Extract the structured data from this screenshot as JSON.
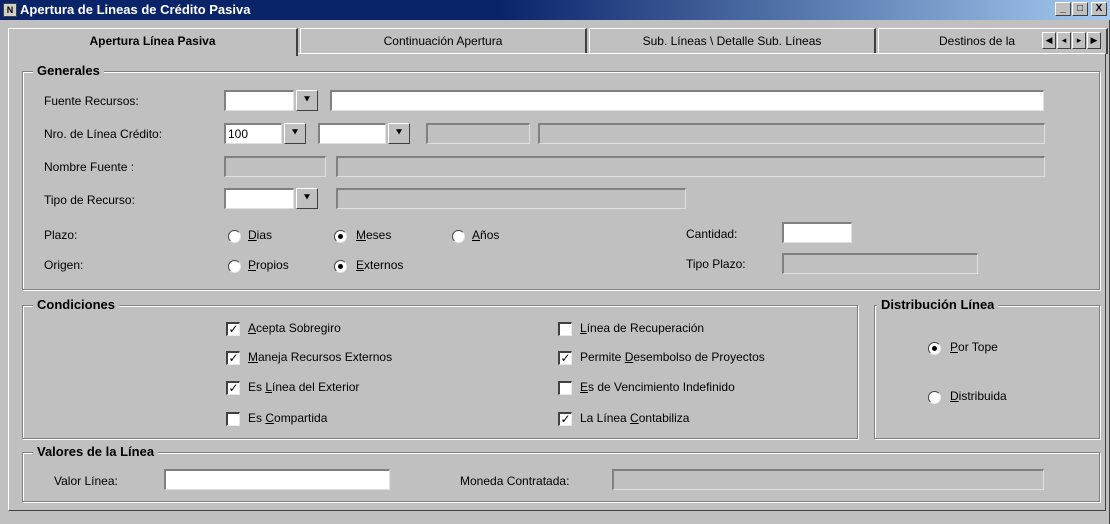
{
  "window": {
    "title": "Apertura de Lineas de Crédito Pasiva",
    "icon_label": "N",
    "controls": [
      "_",
      "□",
      "X"
    ]
  },
  "tabs": [
    {
      "label": "Apertura Línea Pasiva",
      "active": true
    },
    {
      "label": "Continuación Apertura",
      "active": false
    },
    {
      "label": "Sub. Líneas \\ Detalle Sub. Líneas",
      "active": false
    },
    {
      "label": "Destinos de la",
      "active": false
    }
  ],
  "tab_nav": [
    "first-icon",
    "prev-icon",
    "next-icon",
    "last-icon"
  ],
  "generales": {
    "title": "Generales",
    "fuente_recursos": {
      "label": "Fuente Recursos:",
      "code": "",
      "description": ""
    },
    "nro_linea": {
      "label": "Nro. de Línea Crédito:",
      "value": "100",
      "sub": "",
      "field3": "",
      "field4": ""
    },
    "nombre_fuente": {
      "label": "Nombre Fuente :",
      "code": "",
      "description": ""
    },
    "tipo_recurso": {
      "label": "Tipo de Recurso:",
      "code": "",
      "description": ""
    },
    "plazo": {
      "label": "Plazo:",
      "options": [
        {
          "pre": "",
          "u": "D",
          "post": "ias",
          "selected": false
        },
        {
          "pre": "",
          "u": "M",
          "post": "eses",
          "selected": true
        },
        {
          "pre": "",
          "u": "A",
          "post": "ños",
          "selected": false
        }
      ]
    },
    "origen": {
      "label": "Origen:",
      "options": [
        {
          "pre": "",
          "u": "P",
          "post": "ropios",
          "selected": false
        },
        {
          "pre": "",
          "u": "E",
          "post": "xternos",
          "selected": true
        }
      ]
    },
    "cantidad": {
      "label": "Cantidad:",
      "value": ""
    },
    "tipo_plazo": {
      "label": "Tipo Plazo:",
      "value": ""
    }
  },
  "condiciones": {
    "title": "Condiciones",
    "items": [
      {
        "pre": "",
        "u": "A",
        "post": "cepta Sobregiro",
        "checked": true
      },
      {
        "pre": "",
        "u": "M",
        "post": "aneja Recursos Externos",
        "checked": true
      },
      {
        "pre": "Es ",
        "u": "L",
        "post": "ínea del Exterior",
        "checked": true
      },
      {
        "pre": "Es ",
        "u": "C",
        "post": "ompartida",
        "checked": false
      },
      {
        "pre": "",
        "u": "L",
        "post": "ínea de Recuperación",
        "checked": false
      },
      {
        "pre": "Permite ",
        "u": "D",
        "post": "esembolso de Proyectos",
        "checked": true
      },
      {
        "pre": "",
        "u": "E",
        "post": "s de Vencimiento Indefinido",
        "checked": false
      },
      {
        "pre": "La Línea ",
        "u": "C",
        "post": "ontabiliza",
        "checked": true
      }
    ]
  },
  "distribucion": {
    "title": "Distribución Línea",
    "options": [
      {
        "pre": "",
        "u": "P",
        "post": "or Tope",
        "selected": true
      },
      {
        "pre": "",
        "u": "D",
        "post": "istribuida",
        "selected": false
      }
    ]
  },
  "valores": {
    "title": "Valores de la Línea",
    "valor_linea": {
      "label": "Valor Línea:",
      "value": ""
    },
    "moneda": {
      "label": "Moneda Contratada:",
      "value": ""
    }
  },
  "colors": {
    "title_start": "#0a246a",
    "title_end": "#a6caf0",
    "face": "#c0c0c0"
  }
}
